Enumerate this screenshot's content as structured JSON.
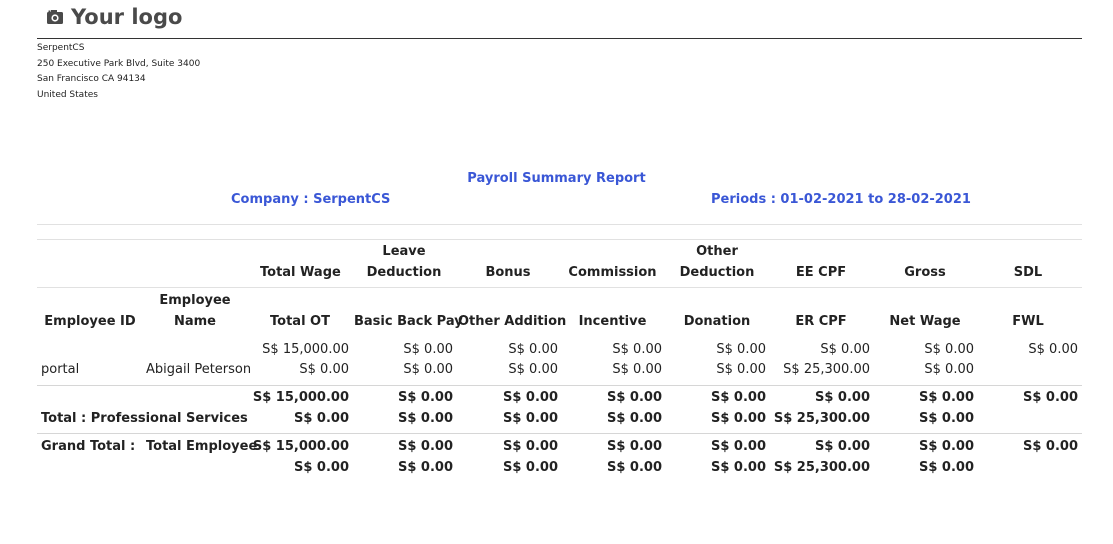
{
  "header": {
    "logo_text": "Your logo",
    "logo_icon": "camera-icon",
    "company_lines": [
      "SerpentCS",
      "250 Executive Park Blvd, Suite 3400",
      "San Francisco CA 94134",
      "United States"
    ]
  },
  "report": {
    "title": "Payroll Summary Report",
    "company": "Company : SerpentCS",
    "periods": "Periods : 01-02-2021 to 28-02-2021"
  },
  "columns": {
    "row1": [
      "Total Wage",
      "Leave\nDeduction",
      "Bonus",
      "Commission",
      "Other\nDeduction",
      "EE CPF",
      "Gross",
      "SDL"
    ],
    "employee_id": "Employee ID",
    "employee_name": "Employee\nName",
    "row2": [
      "Total OT",
      "Basic Back Pay",
      "Other Addition",
      "Incentive",
      "Donation",
      "ER CPF",
      "Net Wage",
      "FWL"
    ]
  },
  "rows": {
    "employee": {
      "id": "portal",
      "name": "Abigail Peterson",
      "line1": [
        "S$ 15,000.00",
        "S$ 0.00",
        "S$ 0.00",
        "S$ 0.00",
        "S$ 0.00",
        "S$ 0.00",
        "S$ 0.00",
        "S$ 0.00"
      ],
      "line2": [
        "S$ 0.00",
        "S$ 0.00",
        "S$ 0.00",
        "S$ 0.00",
        "S$ 0.00",
        "S$ 25,300.00",
        "S$ 0.00",
        ""
      ]
    },
    "department_total": {
      "label": "Total : Professional Services",
      "line1": [
        "S$ 15,000.00",
        "S$ 0.00",
        "S$ 0.00",
        "S$ 0.00",
        "S$ 0.00",
        "S$ 0.00",
        "S$ 0.00",
        "S$ 0.00"
      ],
      "line2": [
        "S$ 0.00",
        "S$ 0.00",
        "S$ 0.00",
        "S$ 0.00",
        "S$ 0.00",
        "S$ 25,300.00",
        "S$ 0.00",
        ""
      ]
    },
    "grand_total": {
      "label": "Grand Total :",
      "employee_label": "Total Employee",
      "line1": [
        "S$ 15,000.00",
        "S$ 0.00",
        "S$ 0.00",
        "S$ 0.00",
        "S$ 0.00",
        "S$ 0.00",
        "S$ 0.00",
        "S$ 0.00"
      ],
      "line2": [
        "S$ 0.00",
        "S$ 0.00",
        "S$ 0.00",
        "S$ 0.00",
        "S$ 0.00",
        "S$ 25,300.00",
        "S$ 0.00",
        ""
      ]
    }
  },
  "colors": {
    "accent": "#3a57d6",
    "text": "#222222",
    "rule": "#e1e1e1"
  }
}
